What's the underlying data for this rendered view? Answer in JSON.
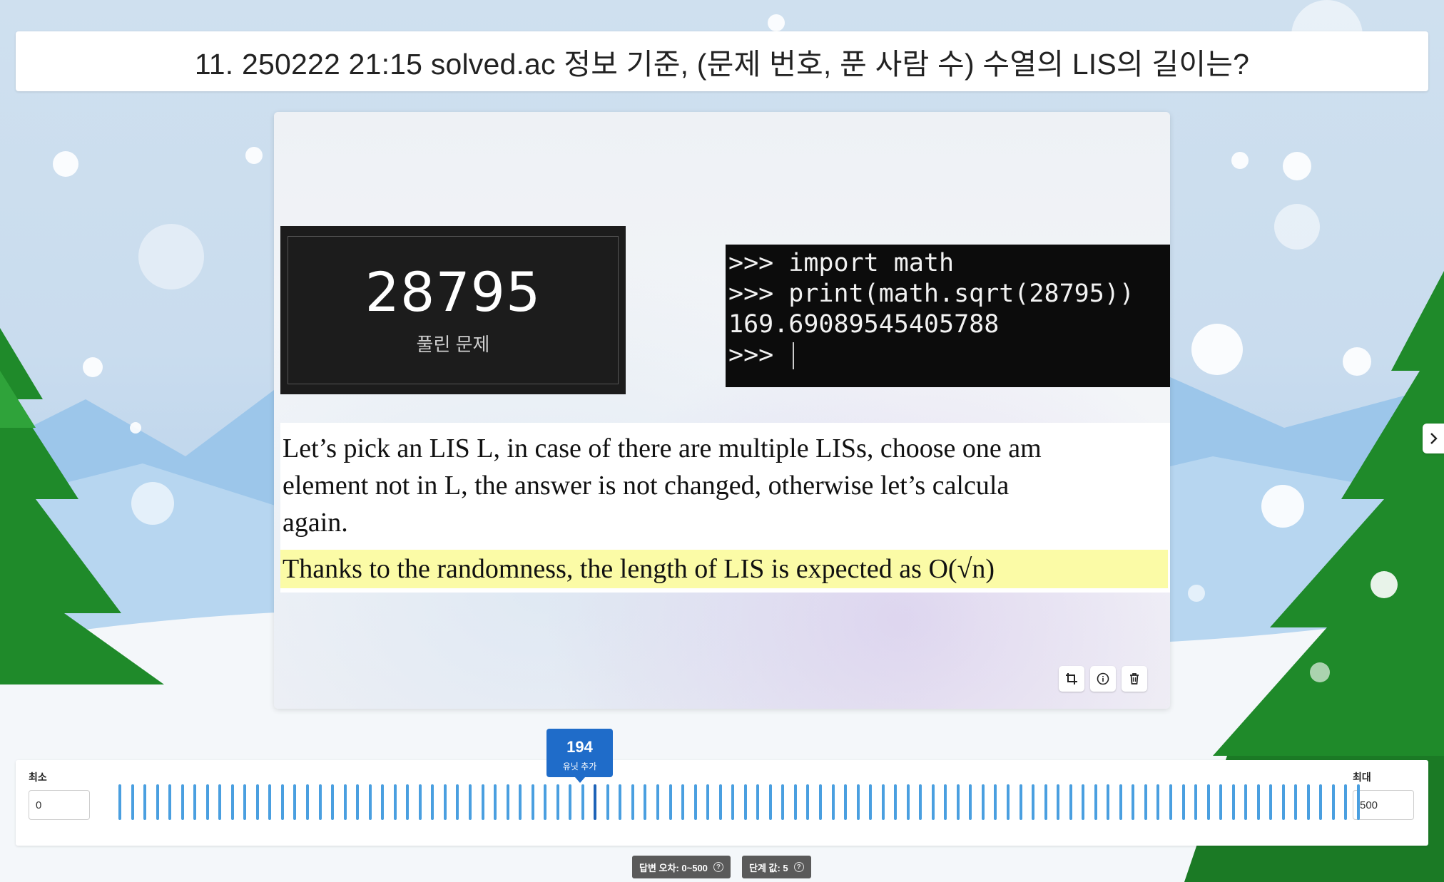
{
  "question": {
    "title": "11. 250222 21:15 solved.ac 정보 기준, (문제 번호, 푼 사람 수) 수열의 LIS의 길이는?"
  },
  "image": {
    "stat_number": "28795",
    "stat_label": "풀린 문제",
    "terminal_lines": [
      ">>> import math",
      ">>> print(math.sqrt(28795))",
      "169.69089545405788",
      ">>> "
    ],
    "paper_lines": [
      "Let’s pick an LIS L, in case of there are multiple LISs, choose one am",
      "element not in L, the answer is not changed, otherwise let’s calcula",
      "again."
    ],
    "paper_highlight": "Thanks to the randomness, the length of LIS is expected as O(√n)",
    "tools": [
      "crop-icon",
      "info-icon",
      "trash-icon"
    ]
  },
  "slider": {
    "min_label": "최소",
    "min_value": "0",
    "max_label": "최대",
    "max_value": "500",
    "current_value": "194",
    "current_caption": "유닛 추가",
    "range_min": 0,
    "range_max": 500,
    "tick_count": 100
  },
  "badges": {
    "tolerance": "답변 오차: 0~500",
    "step": "단계 값: 5"
  },
  "colors": {
    "accent": "#1f6cc9",
    "tick": "#4a9fe0",
    "highlight": "#fbfba6"
  }
}
